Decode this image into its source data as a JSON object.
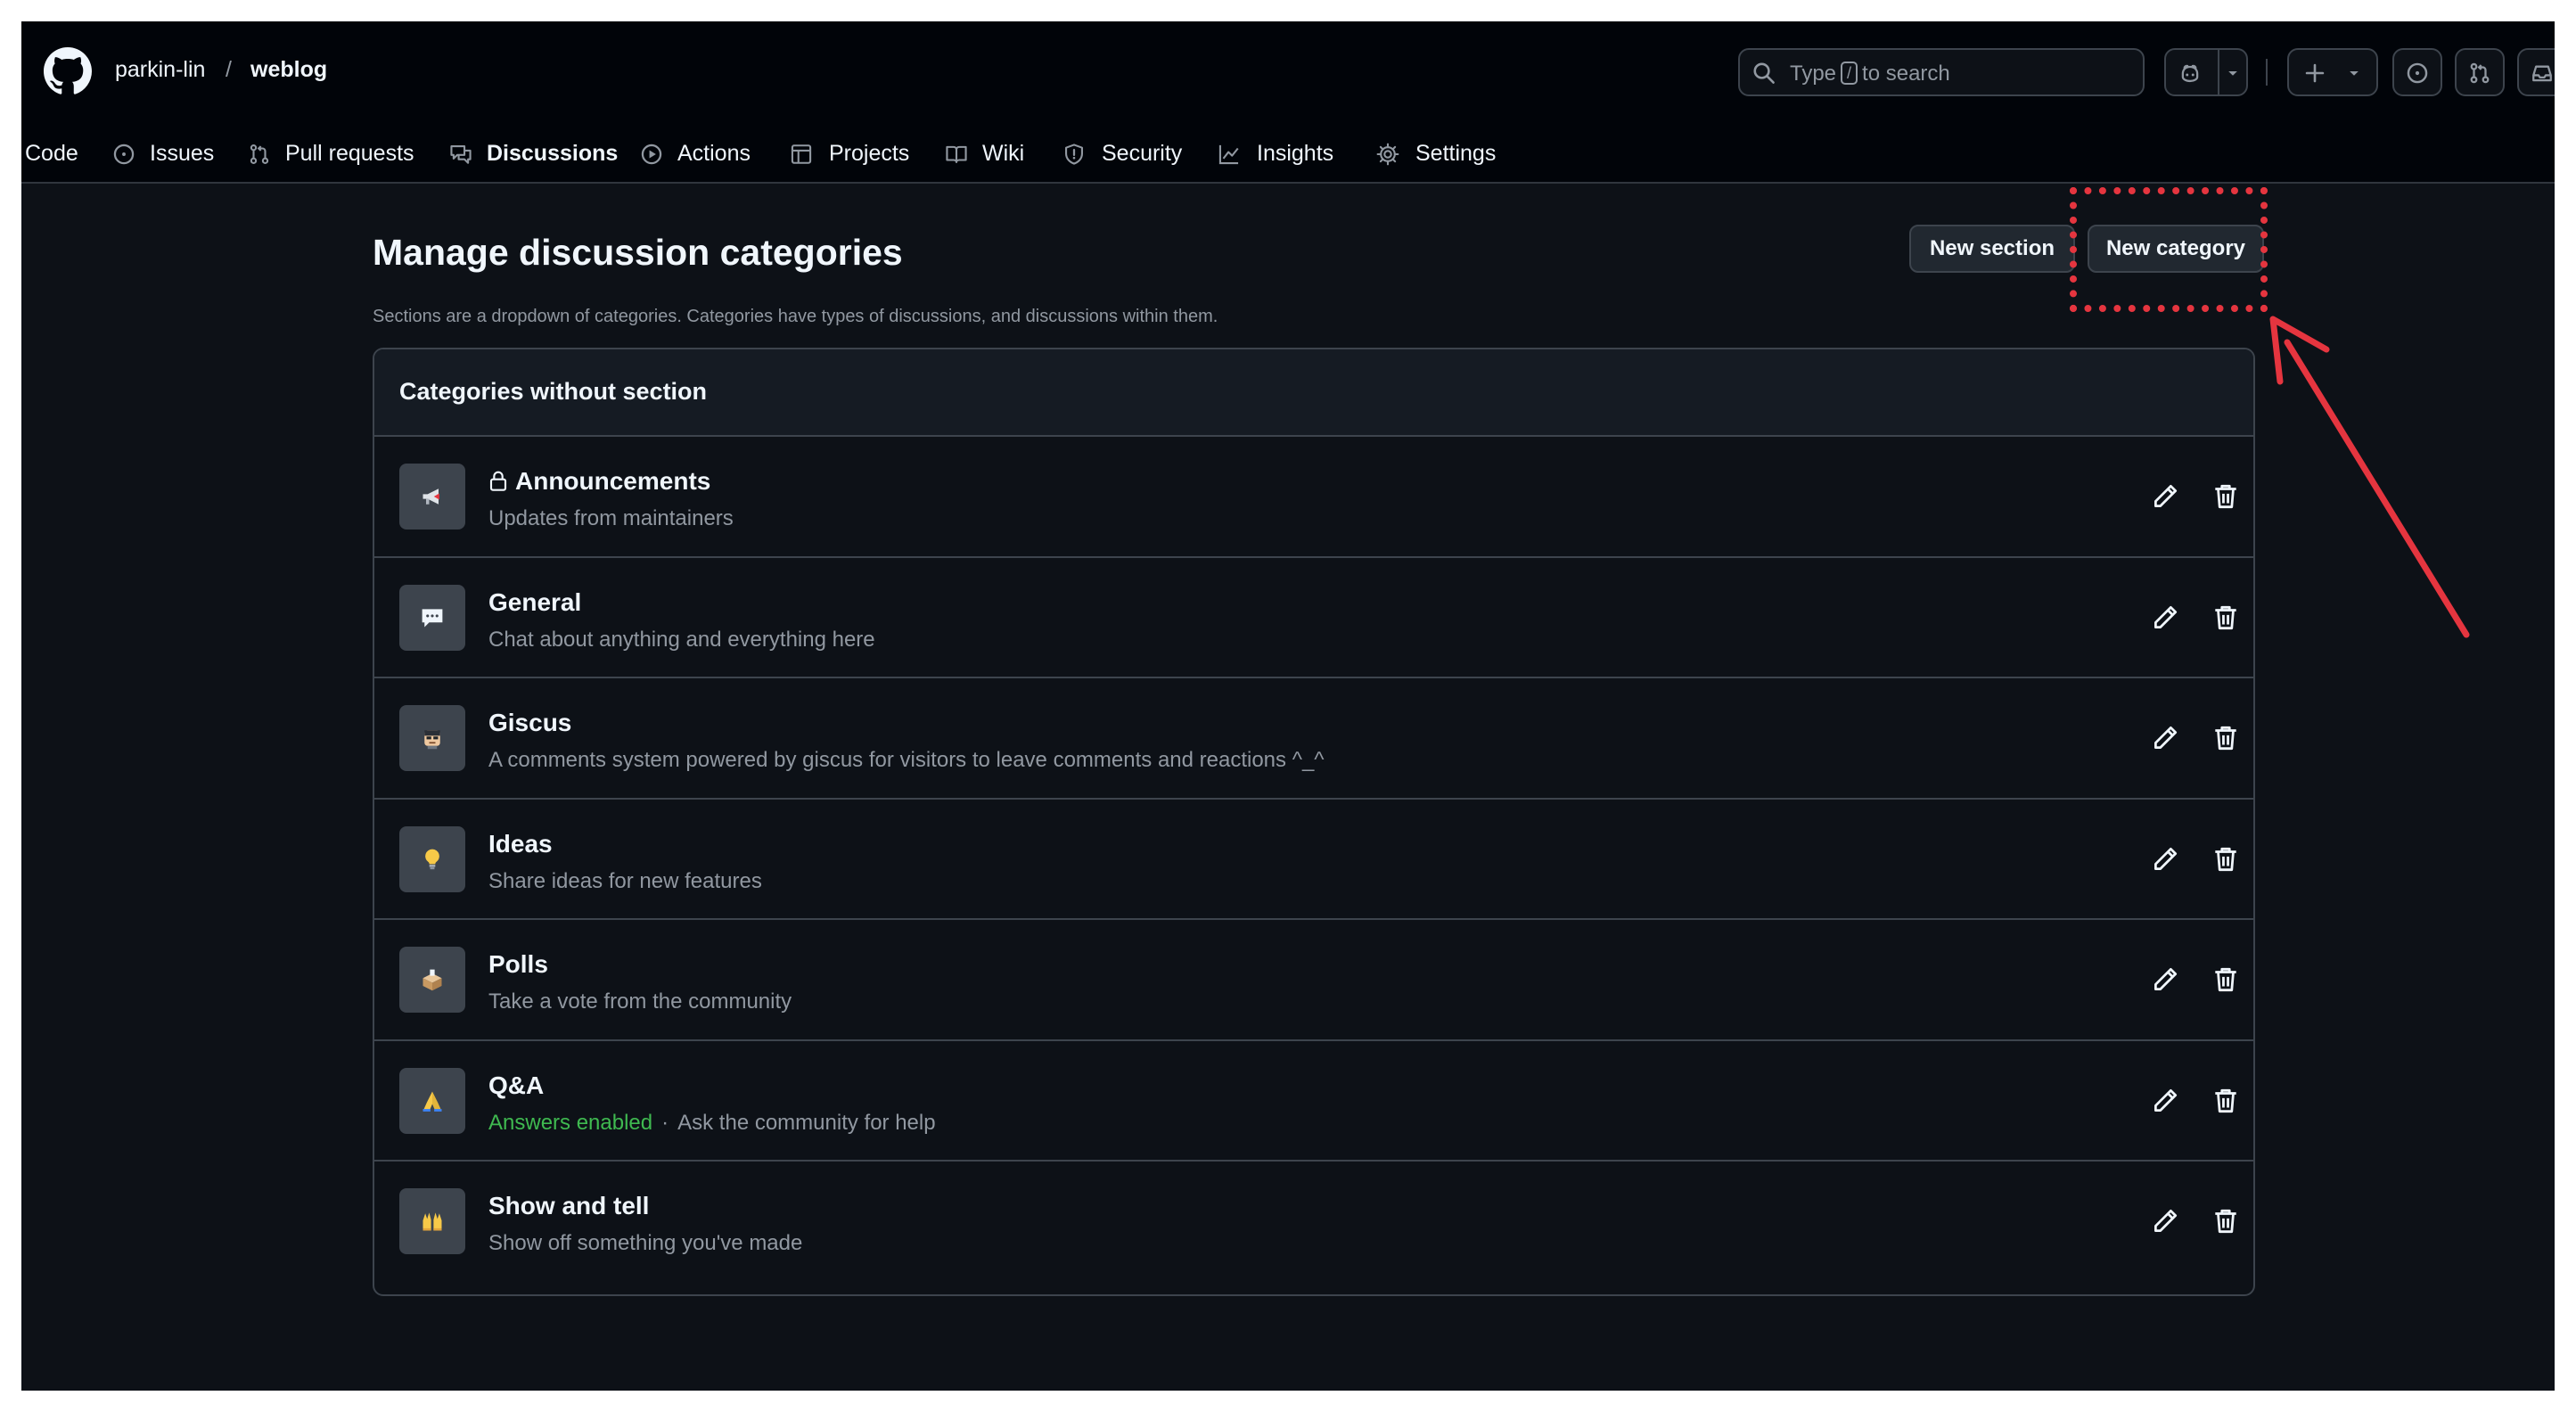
{
  "header": {
    "owner": "parkin-lin",
    "separator": "/",
    "repo": "weblog",
    "search": {
      "prefix": "Type",
      "key": "/",
      "suffix": "to search"
    },
    "icons": [
      "github-logo-icon",
      "search-icon",
      "copilot-icon",
      "chevron-down-icon",
      "plus-icon",
      "issue-opened-icon",
      "git-pull-request-icon",
      "inbox-icon"
    ]
  },
  "nav": {
    "tabs": [
      {
        "label": "Code",
        "icon": "code-icon"
      },
      {
        "label": "Issues",
        "icon": "issue-opened-icon"
      },
      {
        "label": "Pull requests",
        "icon": "git-pull-request-icon"
      },
      {
        "label": "Discussions",
        "icon": "comment-discussion-icon",
        "active": true
      },
      {
        "label": "Actions",
        "icon": "play-icon"
      },
      {
        "label": "Projects",
        "icon": "table-icon"
      },
      {
        "label": "Wiki",
        "icon": "book-icon"
      },
      {
        "label": "Security",
        "icon": "shield-icon"
      },
      {
        "label": "Insights",
        "icon": "graph-icon"
      },
      {
        "label": "Settings",
        "icon": "gear-icon"
      }
    ]
  },
  "main": {
    "title": "Manage discussion categories",
    "description": "Sections are a dropdown of categories. Categories have types of discussions, and discussions within them.",
    "new_section_label": "New section",
    "new_category_label": "New category",
    "panel_title": "Categories without section",
    "categories": [
      {
        "name": "Announcements",
        "locked": true,
        "description": "Updates from maintainers",
        "emoji": "loudspeaker-icon"
      },
      {
        "name": "General",
        "description": "Chat about anything and everything here",
        "emoji": "speech-balloon-icon"
      },
      {
        "name": "Giscus",
        "description": "A comments system powered by giscus for visitors to leave comments and reactions ^_^",
        "emoji": "giscus-face-icon"
      },
      {
        "name": "Ideas",
        "description": "Share ideas for new features",
        "emoji": "light-bulb-icon"
      },
      {
        "name": "Polls",
        "description": "Take a vote from the community",
        "emoji": "ballot-box-icon"
      },
      {
        "name": "Q&A",
        "answers_label": "Answers enabled",
        "separator": "·",
        "description": "Ask the community for help",
        "emoji": "folded-hands-icon"
      },
      {
        "name": "Show and tell",
        "description": "Show off something you've made",
        "emoji": "raised-hands-icon"
      }
    ]
  },
  "colors": {
    "background": "#0d1117",
    "header": "#010409",
    "border": "#3d444d",
    "text": "#f0f6fc",
    "muted": "#9198a1",
    "active_tab_underline": "#f78166",
    "answers_enabled": "#3fb950",
    "annotation": "#e5353f"
  }
}
